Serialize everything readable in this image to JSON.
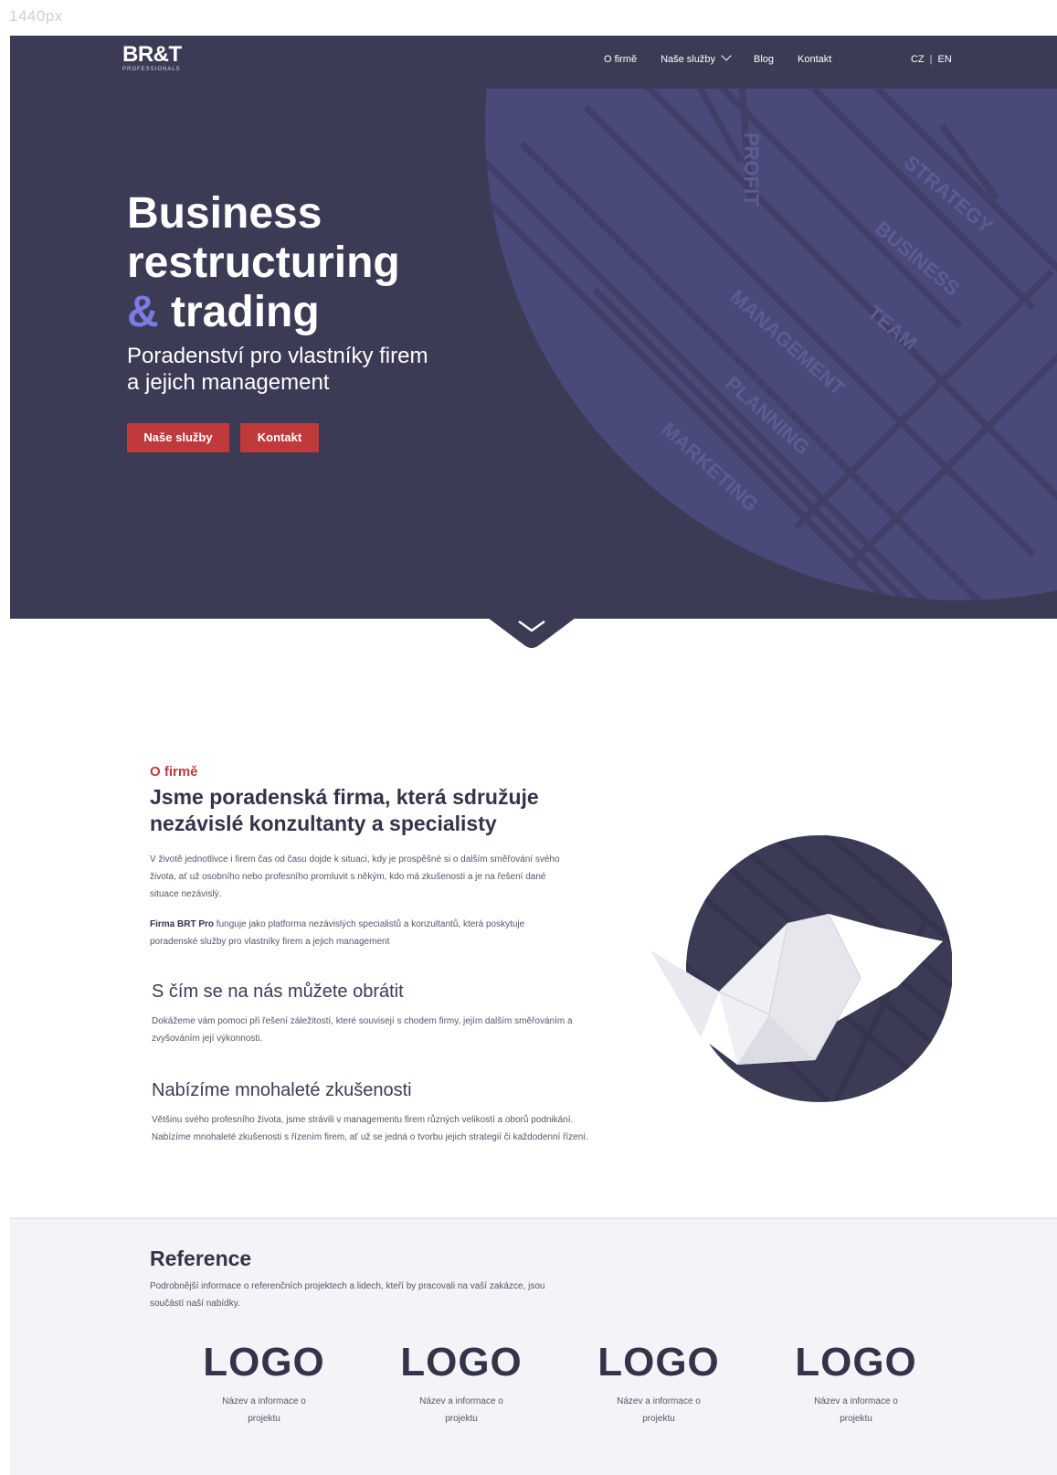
{
  "canvas_label": "1440px",
  "brand": {
    "name": "BR&T",
    "tagline": "PROFESSIONALS"
  },
  "nav": {
    "items": [
      "O firmě",
      "Naše služby",
      "Blog",
      "Kontakt"
    ],
    "lang_cz": "CZ",
    "lang_sep": "|",
    "lang_en": "EN"
  },
  "hero": {
    "title_line1": "Business",
    "title_line2": "restructuring",
    "title_amp": "&",
    "title_line3": "trading",
    "subtitle": "Poradenství pro vlastníky firem a jejich management",
    "btn_services": "Naše služby",
    "btn_contact": "Kontakt",
    "deco_words": [
      "PROFIT",
      "STRATEGY",
      "BUSINESS",
      "TEAM",
      "MANAGEMENT",
      "PLANNING",
      "MARKETING"
    ]
  },
  "about": {
    "kicker": "O firmě",
    "heading": "Jsme poradenská firma, která sdružuje nezávislé konzultanty a specialisty",
    "p1": "V životě jednotlivce i firem čas od času dojde k situaci, kdy je prospěšné si o dalším směřování svého života, ať už osobního nebo profesního promluvit s někým, kdo má zkušenosti a je na řešení dané situace nezávislý.",
    "p2_bold": "Firma BRT Pro",
    "p2_rest": " funguje jako platforma nezávislých specialistů a konzultantů, která poskytuje poradenské služby pro vlastníky firem a jejich management",
    "sub1": "S čím se na nás můžete obrátit",
    "p3": "Dokážeme vám pomoci při řešení záležitostí, které souvisejí s chodem firmy, jejím dalším směřováním a zvyšováním její výkonnosti.",
    "sub2": "Nabízíme mnohaleté zkušenosti",
    "p4": "Většinu svého profesního života, jsme strávili v managementu firem různých velikostí a oborů podnikání. Nabízíme mnohaleté zkušenosti s řízením firem, ať už se jedná o tvorbu jejich strategií či každodenní řízení."
  },
  "reference": {
    "title": "Reference",
    "desc": "Podrobnější informace o referenčních projektech a lidech, kteří by pracovali na vaší zakázce, jsou součástí naší nabídky.",
    "logos": [
      {
        "logo": "LOGO",
        "caption": "Název a informace o projektu"
      },
      {
        "logo": "LOGO",
        "caption": "Název a informace o projektu"
      },
      {
        "logo": "LOGO",
        "caption": "Název a informace o projektu"
      },
      {
        "logo": "LOGO",
        "caption": "Název a informace o projektu"
      }
    ]
  },
  "colors": {
    "navy": "#3b3b56",
    "accent_red": "#c0393b",
    "accent_violet": "#7b7be0",
    "light_bg": "#f3f3f8"
  }
}
